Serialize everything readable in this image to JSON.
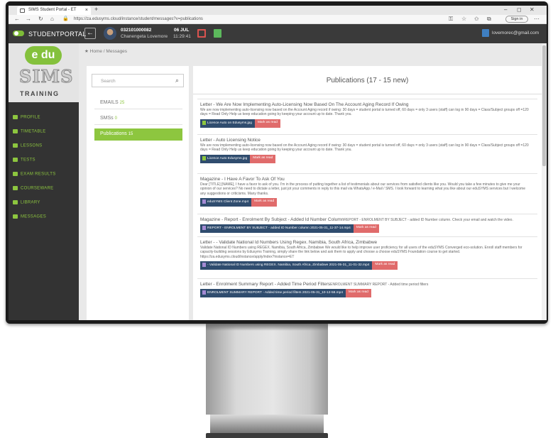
{
  "browser": {
    "tab_title": "SIMS Student Portal - ET",
    "tab_close": "×",
    "new_tab": "+",
    "url": "https://za.edusyms.cloud/instance/student/messages?v=publications",
    "sign_in": "Sign in",
    "window_controls": [
      "–",
      "◻",
      "✕"
    ]
  },
  "header": {
    "brand": "STUDENTPORTAL",
    "back_glyph": "←",
    "student_id": "032101000082",
    "student_name": "Chanengeta Lovemore",
    "date": "06 JUL",
    "time": "11:29:41",
    "email": "lovemorec@gmail.com"
  },
  "logo": {
    "du": "e du",
    "sims": "SIMS",
    "training": "TRAINING"
  },
  "sidebar": {
    "items": [
      {
        "label": "PROFILE",
        "icon": "home-icon"
      },
      {
        "label": "TIMETABLE",
        "icon": "clock-icon"
      },
      {
        "label": "LESSONS",
        "icon": "people-icon"
      },
      {
        "label": "TESTS",
        "icon": "test-icon"
      },
      {
        "label": "EXAM RESULTS",
        "icon": "edit-icon"
      },
      {
        "label": "COURSEWARE",
        "icon": "globe-icon"
      },
      {
        "label": "LIBRARY",
        "icon": "user-icon"
      },
      {
        "label": "MESSAGES",
        "icon": "message-icon"
      }
    ]
  },
  "breadcrumb": {
    "home": "Home",
    "sep": "/",
    "current": "Messages"
  },
  "left_panel": {
    "search_placeholder": "Search",
    "folders": [
      {
        "label": "EMAILS",
        "count": "25"
      },
      {
        "label": "SMSs",
        "count": "0"
      },
      {
        "label": "Publications",
        "count": "15"
      }
    ]
  },
  "publications": {
    "heading": "Publications (17 - 15 new)",
    "mark_label": "Mark as read",
    "messages": [
      {
        "title": "Letter - We Are Now Implementing Auto-Licensing Now Based On The Account Aging Record If Owing",
        "body": "We are now implementing auto-licensing now based on the Account Aging record if owing: 30 days = student portal is turned off, 60 days = only 3 users (staff) can log in 90 days = Class/Subject groups off =120 days = Read Only Help us keep education going by keeping your account up to date. Thank you.",
        "attachment": "Licence Auto on Edusyms.jpg"
      },
      {
        "title": "Letter - Auto Licensing Notice",
        "body": "We are now implementing auto-licensing now based on the Account Aging record if owing: 30 days = student portal is turned off, 60 days = only 3 users (staff) can log in 90 days = Class/Subject groups off =120 days = Read Only Help us keep education going by keeping your account up to date. Thank you.",
        "attachment": "Licence Auto Edusyms.jpg"
      },
      {
        "title": "Magazine - I Have A Favor To Ask Of You",
        "body": "Dear [TITLE] [NAME], I have a favor to ask of you. I'm in the process of putting together a list of testimonials about our services from satisfied clients like you. Would you take a few minutes to give me your opinion of our services? No need to dictate a letter, just jot your comments in reply to this mail via WhatsApp / e-Mail / SMS. I look forward to learning what you like about our eduSYMS services but I welcome any suggestions or criticisms. Many thanks.",
        "attachment": "eduSYMS Client Zone.mp4"
      },
      {
        "title": "Magazine - Report - Enrolment By Subject - Added Id Number Column",
        "inline": "REPORT - ENROLMENT BY SUBJECT - added ID Number column. Check your email and watch the video.",
        "body": "",
        "attachment": "REPORT - ENROLMENT BY SUBJECT - added ID Number column 2021-05-31_11-37-14.mp4"
      },
      {
        "title": "Letter - - Validate National Id Numbers Using Regex. Namibia, South Africa, Zimbabwe",
        "body": "Validate National ID Numbers using REGEX. Namibia, South Africa, Zimbabwe We would like to help improve user proficiency for all users of the eduSYMS Converged eco-solution. Enroll staff members for capacity-building sessions by Edusyms Training, simply share the link below and ask them to apply and choose a choose eduSYMS Foundation course to get started. https://za.edusyms.cloud/instance/apply/index?instance=ET",
        "attachment": "- Validate National ID Numbers using REGEX. Namibia, South Africa, Zimbabwe 2021-05-31_11-01-32.mp4"
      },
      {
        "title": "Letter - Enrolment Summary Report - Added Time Period Filters",
        "inline": "ENROLMENT SUMMARY REPORT - Added time period filters",
        "body": "",
        "attachment": "ENROLMENT SUMMARY REPORT - Added time period filters 2021-05-31_10-12-58.mp4"
      }
    ]
  }
}
